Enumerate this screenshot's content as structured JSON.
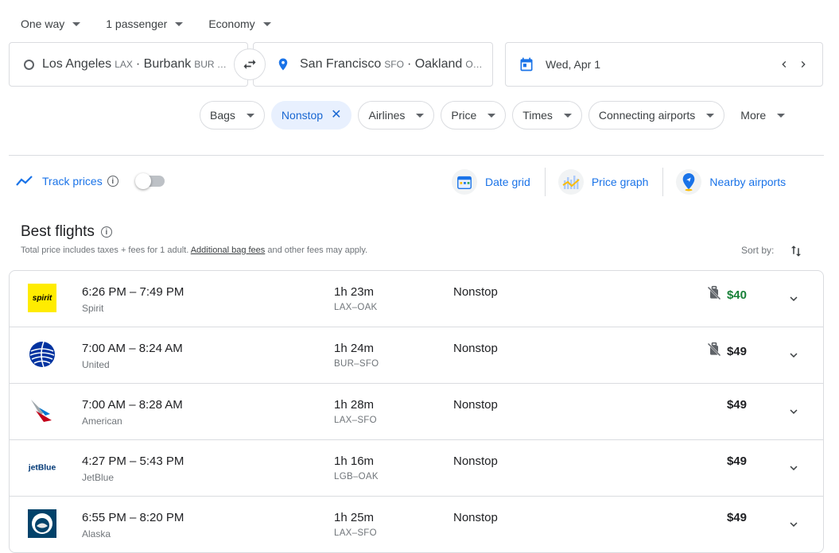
{
  "top": {
    "trip_type": "One way",
    "passengers": "1 passenger",
    "cabin": "Economy"
  },
  "search": {
    "from_city": "Los Angeles",
    "from_code": "LAX",
    "from_more": "· Burbank",
    "from_more_code": "BUR …",
    "to_city": "San Francisco",
    "to_code": "SFO",
    "to_more": "· Oakland",
    "to_more_code": "O…",
    "date": "Wed, Apr 1"
  },
  "filters": [
    {
      "label": "Bags",
      "active": false
    },
    {
      "label": "Nonstop",
      "active": true
    },
    {
      "label": "Airlines",
      "active": false
    },
    {
      "label": "Price",
      "active": false
    },
    {
      "label": "Times",
      "active": false
    },
    {
      "label": "Connecting airports",
      "active": false
    },
    {
      "label": "More",
      "active": false
    }
  ],
  "track_prices": "Track prices",
  "tools": {
    "date_grid": "Date grid",
    "price_graph": "Price graph",
    "nearby_airports": "Nearby airports"
  },
  "best": {
    "title": "Best flights",
    "note_prefix": "Total price includes taxes + fees for 1 adult. ",
    "note_link": "Additional bag fees",
    "note_suffix": " and other fees may apply.",
    "sort_label": "Sort by:"
  },
  "flights": [
    {
      "times": "6:26 PM – 7:49 PM",
      "airline": "Spirit",
      "duration": "1h 23m",
      "route": "LAX–OAK",
      "stops": "Nonstop",
      "price": "$40",
      "green": true,
      "no_bag": true,
      "logo": "spirit"
    },
    {
      "times": "7:00 AM – 8:24 AM",
      "airline": "United",
      "duration": "1h 24m",
      "route": "BUR–SFO",
      "stops": "Nonstop",
      "price": "$49",
      "green": false,
      "no_bag": true,
      "logo": "united"
    },
    {
      "times": "7:00 AM – 8:28 AM",
      "airline": "American",
      "duration": "1h 28m",
      "route": "LAX–SFO",
      "stops": "Nonstop",
      "price": "$49",
      "green": false,
      "no_bag": false,
      "logo": "american"
    },
    {
      "times": "4:27 PM – 5:43 PM",
      "airline": "JetBlue",
      "duration": "1h 16m",
      "route": "LGB–OAK",
      "stops": "Nonstop",
      "price": "$49",
      "green": false,
      "no_bag": false,
      "logo": "jetblue"
    },
    {
      "times": "6:55 PM – 8:20 PM",
      "airline": "Alaska",
      "duration": "1h 25m",
      "route": "LAX–SFO",
      "stops": "Nonstop",
      "price": "$49",
      "green": false,
      "no_bag": false,
      "logo": "alaska"
    }
  ],
  "logos": {
    "spirit": "spirit",
    "jetblue": "jetBlue"
  }
}
